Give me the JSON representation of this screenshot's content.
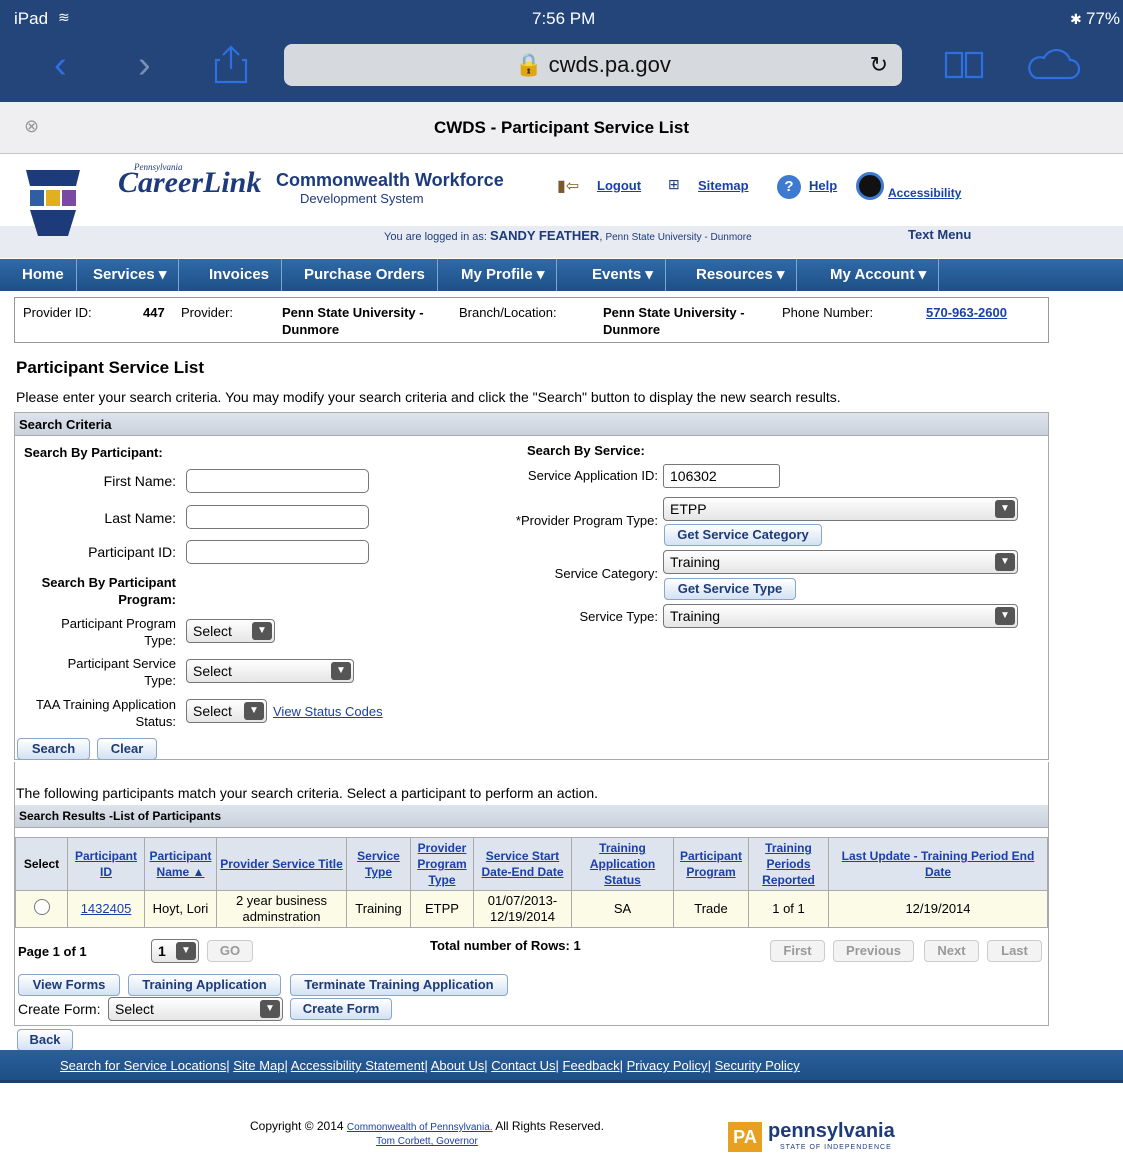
{
  "status_bar": {
    "device": "iPad",
    "time": "7:56 PM",
    "battery": "77%"
  },
  "browser": {
    "url": "cwds.pa.gov",
    "tab_title": "CWDS - Participant Service List"
  },
  "header": {
    "logo_small": "Pennsylvania",
    "logo": "CareerLink",
    "system_line1": "Commonwealth Workforce",
    "system_line2": "Development System",
    "logout": "Logout",
    "sitemap": "Sitemap",
    "help": "Help",
    "accessibility": "Accessibility",
    "logged_in_prefix": "You are logged in as:",
    "logged_in_user": "SANDY FEATHER",
    "logged_in_org": "Penn State University - Dunmore",
    "text_menu": "Text Menu"
  },
  "nav": [
    "Home",
    "Services",
    "Invoices",
    "Purchase Orders",
    "My Profile",
    "Events",
    "Resources",
    "My Account"
  ],
  "provider": {
    "id_label": "Provider ID:",
    "id": "447",
    "provider_label": "Provider:",
    "provider": "Penn State University - Dunmore",
    "branch_label": "Branch/Location:",
    "branch": "Penn State University - Dunmore",
    "phone_label": "Phone Number:",
    "phone": "570-963-2600"
  },
  "page_title": "Participant Service List",
  "instructions": "Please enter your search criteria. You may modify your search criteria and click the \"Search\" button to display the new search results.",
  "search": {
    "bar": "Search Criteria",
    "by_participant": "Search By Participant:",
    "first_name": "First Name:",
    "last_name": "Last Name:",
    "participant_id": "Participant ID:",
    "by_program_1": "Search By Participant",
    "by_program_2": "Program:",
    "program_type_1": "Participant Program",
    "program_type_2": "Type:",
    "program_type_value": "Select",
    "service_type_1": "Participant Service",
    "service_type_2": "Type:",
    "service_type_value": "Select",
    "taa_1": "TAA Training Application",
    "taa_2": "Status:",
    "taa_value": "Select",
    "view_status": "View Status Codes",
    "by_service": "Search By Service:",
    "app_id_label": "Service Application ID:",
    "app_id": "106302",
    "provider_program_label": "*Provider Program Type:",
    "provider_program": "ETPP",
    "get_category": "Get Service Category",
    "category_label": "Service Category:",
    "category": "Training",
    "get_type": "Get Service Type",
    "stype_label": "Service Type:",
    "stype": "Training",
    "search_btn": "Search",
    "clear_btn": "Clear"
  },
  "results": {
    "intro": "The following participants match your search criteria. Select a participant to perform an action.",
    "bar": "Search Results -List of Participants",
    "columns": [
      "Select",
      "Participant ID",
      "Participant Name ▲",
      "Provider Service Title",
      "Service Type",
      "Provider Program Type",
      "Service Start Date-End Date",
      "Training Application Status",
      "Participant Program",
      "Training Periods Reported",
      "Last Update - Training Period End Date"
    ],
    "row": {
      "id": "1432405",
      "name": "Hoyt, Lori",
      "title": "2 year business adminstration",
      "type": "Training",
      "program_type": "ETPP",
      "dates": "01/07/2013-12/19/2014",
      "status": "SA",
      "program": "Trade",
      "periods": "1 of 1",
      "last_update": "12/19/2014"
    },
    "page_label": "Page 1 of 1",
    "page_value": "1",
    "go": "GO",
    "total": "Total number of Rows: 1",
    "first": "First",
    "previous": "Previous",
    "next": "Next",
    "last": "Last",
    "view_forms": "View Forms",
    "training_app": "Training Application",
    "terminate": "Terminate Training Application",
    "create_form_label": "Create Form:",
    "create_form_value": "Select",
    "create_form_btn": "Create Form",
    "back": "Back"
  },
  "footer": {
    "links": [
      "Search for Service Locations",
      "Site Map",
      "Accessibility Statement",
      "About Us",
      "Contact Us",
      "Feedback",
      "Privacy Policy",
      "Security Policy"
    ],
    "copyright_pre": "Copyright © 2014",
    "copyright_link": "Commonwealth of Pennsylvania.",
    "copyright_post": "All Rights Reserved.",
    "governor": "Tom Corbett, Governor",
    "pa_badge": "PA",
    "pa_word": "pennsylvania",
    "pa_tag": "STATE OF INDEPENDENCE"
  }
}
